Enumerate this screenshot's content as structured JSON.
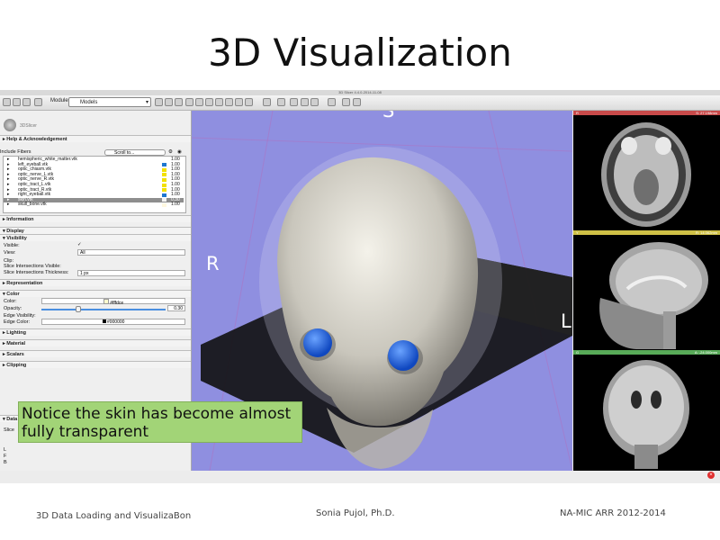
{
  "slide": {
    "title": "3D Visualization",
    "notice": "Notice the skin has become almost fully transparent",
    "footer": {
      "left": "3D Data Loading and VisualizaBon",
      "center": "Sonia Pujol, Ph.D.",
      "right": "NA-MIC ARR 2012-2014"
    }
  },
  "app": {
    "window_title": "3D Slicer 4.4.0-2014-11-08",
    "modules_label": "Modules:",
    "module_selected": "Models",
    "logo_text": "3DSlicer",
    "help_section": "Help & Acknowledgement",
    "include_fibers_label": "Include Fibers",
    "scroll_to_placeholder": "Scroll to...",
    "fibers": [
      {
        "name": "hemispheric_white_matter.vtk",
        "color": "",
        "opacity": "1.00"
      },
      {
        "name": "left_eyeball.vtk",
        "color": "#1f77d0",
        "opacity": "1.00"
      },
      {
        "name": "optic_chiasm.vtk",
        "color": "#f2e000",
        "opacity": "1.00"
      },
      {
        "name": "optic_nerve_L.vtk",
        "color": "#f2e000",
        "opacity": "1.00"
      },
      {
        "name": "optic_nerve_R.vtk",
        "color": "#f2e000",
        "opacity": "1.00"
      },
      {
        "name": "optic_tract_L.vtk",
        "color": "#f2e000",
        "opacity": "1.00"
      },
      {
        "name": "optic_tract_R.vtk",
        "color": "#f2e000",
        "opacity": "1.00"
      },
      {
        "name": "right_eyeball.vtk",
        "color": "#1f77d0",
        "opacity": "1.00"
      },
      {
        "name": "skin.vtk",
        "color": "#f2f2f2",
        "opacity": "0.30",
        "selected": true
      },
      {
        "name": "skull_bone.vtk",
        "color": "#fff8e0",
        "opacity": "1.00"
      }
    ],
    "sections": {
      "information": "Information",
      "display": "Display",
      "visibility": "Visibility",
      "representation": "Representation",
      "color": "Color",
      "lighting": "Lighting",
      "material": "Material",
      "scalars": "Scalars",
      "clipping": "Clipping",
      "data": "Data"
    },
    "visibility": {
      "visible_label": "Visible:",
      "view_label": "View:",
      "view_value": "All",
      "clip_label": "Clip:",
      "slice_vis_label": "Slice Intersections Visible:",
      "slice_thick_label": "Slice Intersections Thickness:",
      "slice_thick_value": "1 px"
    },
    "color_panel": {
      "color_label": "Color:",
      "color_value": "#fffdce",
      "opacity_label": "Opacity:",
      "opacity_value": "0.30",
      "edge_vis_label": "Edge Visibility:",
      "edge_color_label": "Edge Color:",
      "edge_color_value": "#000000"
    },
    "slice_label": "Slice",
    "orientation": {
      "top": "S",
      "left": "R",
      "right": "L"
    },
    "slice_views": [
      {
        "key": "R",
        "value": "S: 27.198mm",
        "color": "#c0392b",
        "bar_color": "#c84a4a"
      },
      {
        "key": "Y",
        "value": "R: 14.062mm",
        "color": "#d4c030",
        "bar_color": "#cfc046"
      },
      {
        "key": "G",
        "value": "A: -24.000mm",
        "color": "#4caa4c",
        "bar_color": "#58aa58"
      }
    ],
    "side_letters": [
      "L",
      "F",
      "B"
    ],
    "close_glyph": "×",
    "checkbox_mark": "✓"
  }
}
